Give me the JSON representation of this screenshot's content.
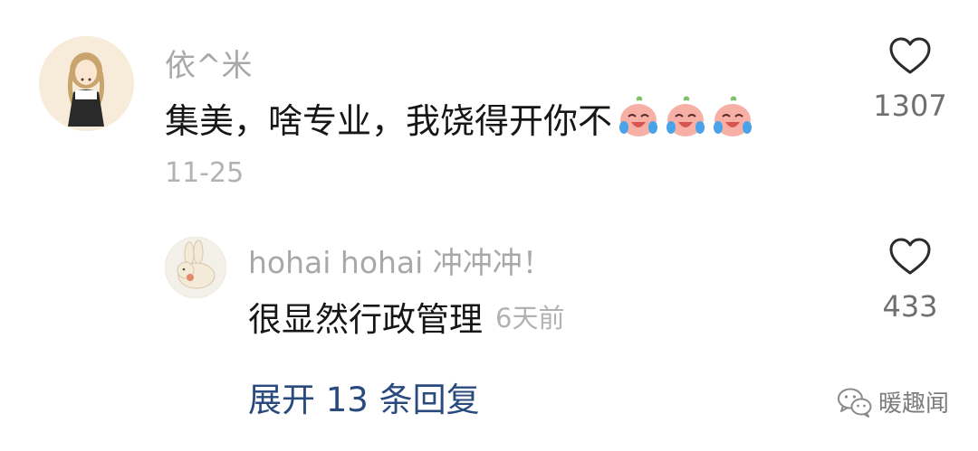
{
  "comment": {
    "username": "依^米",
    "text": "集美，啥专业，我饶得开你不",
    "emoji": [
      "laugh-cry-emoji",
      "laugh-cry-emoji",
      "laugh-cry-emoji"
    ],
    "date": "11-25",
    "likes": "1307"
  },
  "reply": {
    "username": "hohai hohai 冲冲冲！",
    "text": "很显然行政管理",
    "time": "6天前",
    "likes": "433"
  },
  "expand_replies": "展开 13 条回复",
  "watermark": "暖趣闻",
  "colors": {
    "username": "#a8a8a8",
    "content": "#161616",
    "meta": "#b2b2b2",
    "link": "#284a7c",
    "like_count": "#6f6f6f"
  },
  "icons": {
    "like": "heart-outline-icon",
    "watermark": "wechat-icon"
  }
}
